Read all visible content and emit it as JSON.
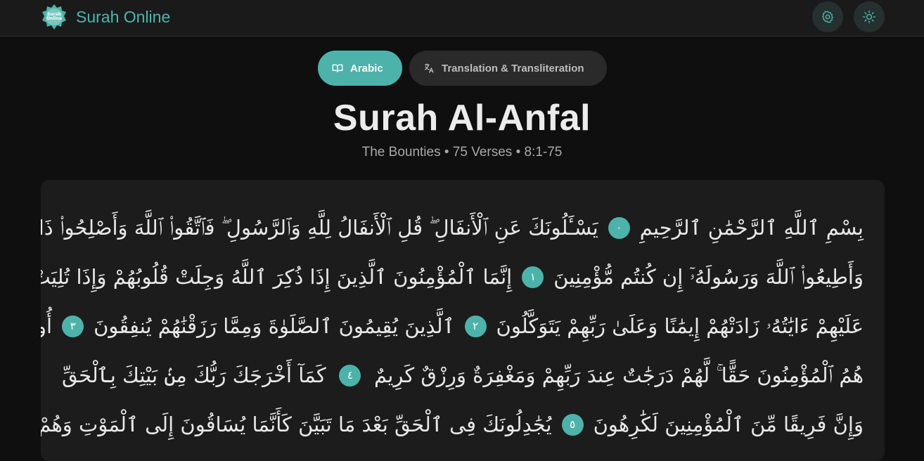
{
  "header": {
    "logo_text": "Surah Online",
    "brand_name": "Surah Online",
    "icons": {
      "settings": "gear-icon",
      "theme": "sun-icon"
    },
    "accent_color": "#4db3aa"
  },
  "tabs": [
    {
      "label": "Arabic",
      "icon": "book-open-icon",
      "active": true
    },
    {
      "label": "Translation & Transliteration",
      "icon": "translate-icon",
      "active": false
    }
  ],
  "surah": {
    "title": "Surah Al-Anfal",
    "subtitle": "The Bounties • 75 Verses • 8:1-75"
  },
  "verses": {
    "lines": [
      [
        "بِسْمِ ٱللَّهِ ٱلرَّحْمَٰنِ ٱلرَّحِيمِ",
        "٠",
        "يَسْـَٔلُونَكَ عَنِ ٱلْأَنفَالِ ۖ قُلِ ٱلْأَنفَالُ لِلَّهِ وَٱلرَّسُولِ ۖ فَٱتَّقُوا۟ ٱللَّهَ وَأَصْلِحُوا۟ ذَاتَ بَيْنِكُمْ ۖ"
      ],
      [
        "وَأَطِيعُوا۟ ٱللَّهَ وَرَسُولَهُۥٓ إِن كُنتُم مُّؤْمِنِينَ",
        "١",
        "إِنَّمَا ٱلْمُؤْمِنُونَ ٱلَّذِينَ إِذَا ذُكِرَ ٱللَّهُ وَجِلَتْ قُلُوبُهُمْ وَإِذَا تُلِيَتْ"
      ],
      [
        "عَلَيْهِمْ ءَايَٰتُهُۥ زَادَتْهُمْ إِيمَٰنًا وَعَلَىٰ رَبِّهِمْ يَتَوَكَّلُونَ",
        "٢",
        "ٱلَّذِينَ يُقِيمُونَ ٱلصَّلَوٰةَ وَمِمَّا رَزَقْنَٰهُمْ يُنفِقُونَ",
        "٣",
        "أُو۟لَٰٓئِكَ"
      ],
      [
        "هُمُ ٱلْمُؤْمِنُونَ حَقًّا ۚ لَّهُمْ دَرَجَٰتٌ عِندَ رَبِّهِمْ وَمَغْفِرَةٌ وَرِزْقٌ كَرِيمٌ",
        "٤",
        "كَمَآ أَخْرَجَكَ رَبُّكَ مِنۢ بَيْتِكَ بِٱلْحَقِّ"
      ],
      [
        "وَإِنَّ فَرِيقًا مِّنَ ٱلْمُؤْمِنِينَ لَكَٰرِهُونَ",
        "٥",
        "يُجَٰدِلُونَكَ فِى ٱلْحَقِّ بَعْدَ مَا تَبَيَّنَ كَأَنَّمَا يُسَاقُونَ إِلَى ٱلْمَوْتِ وَهُمْ"
      ]
    ]
  }
}
